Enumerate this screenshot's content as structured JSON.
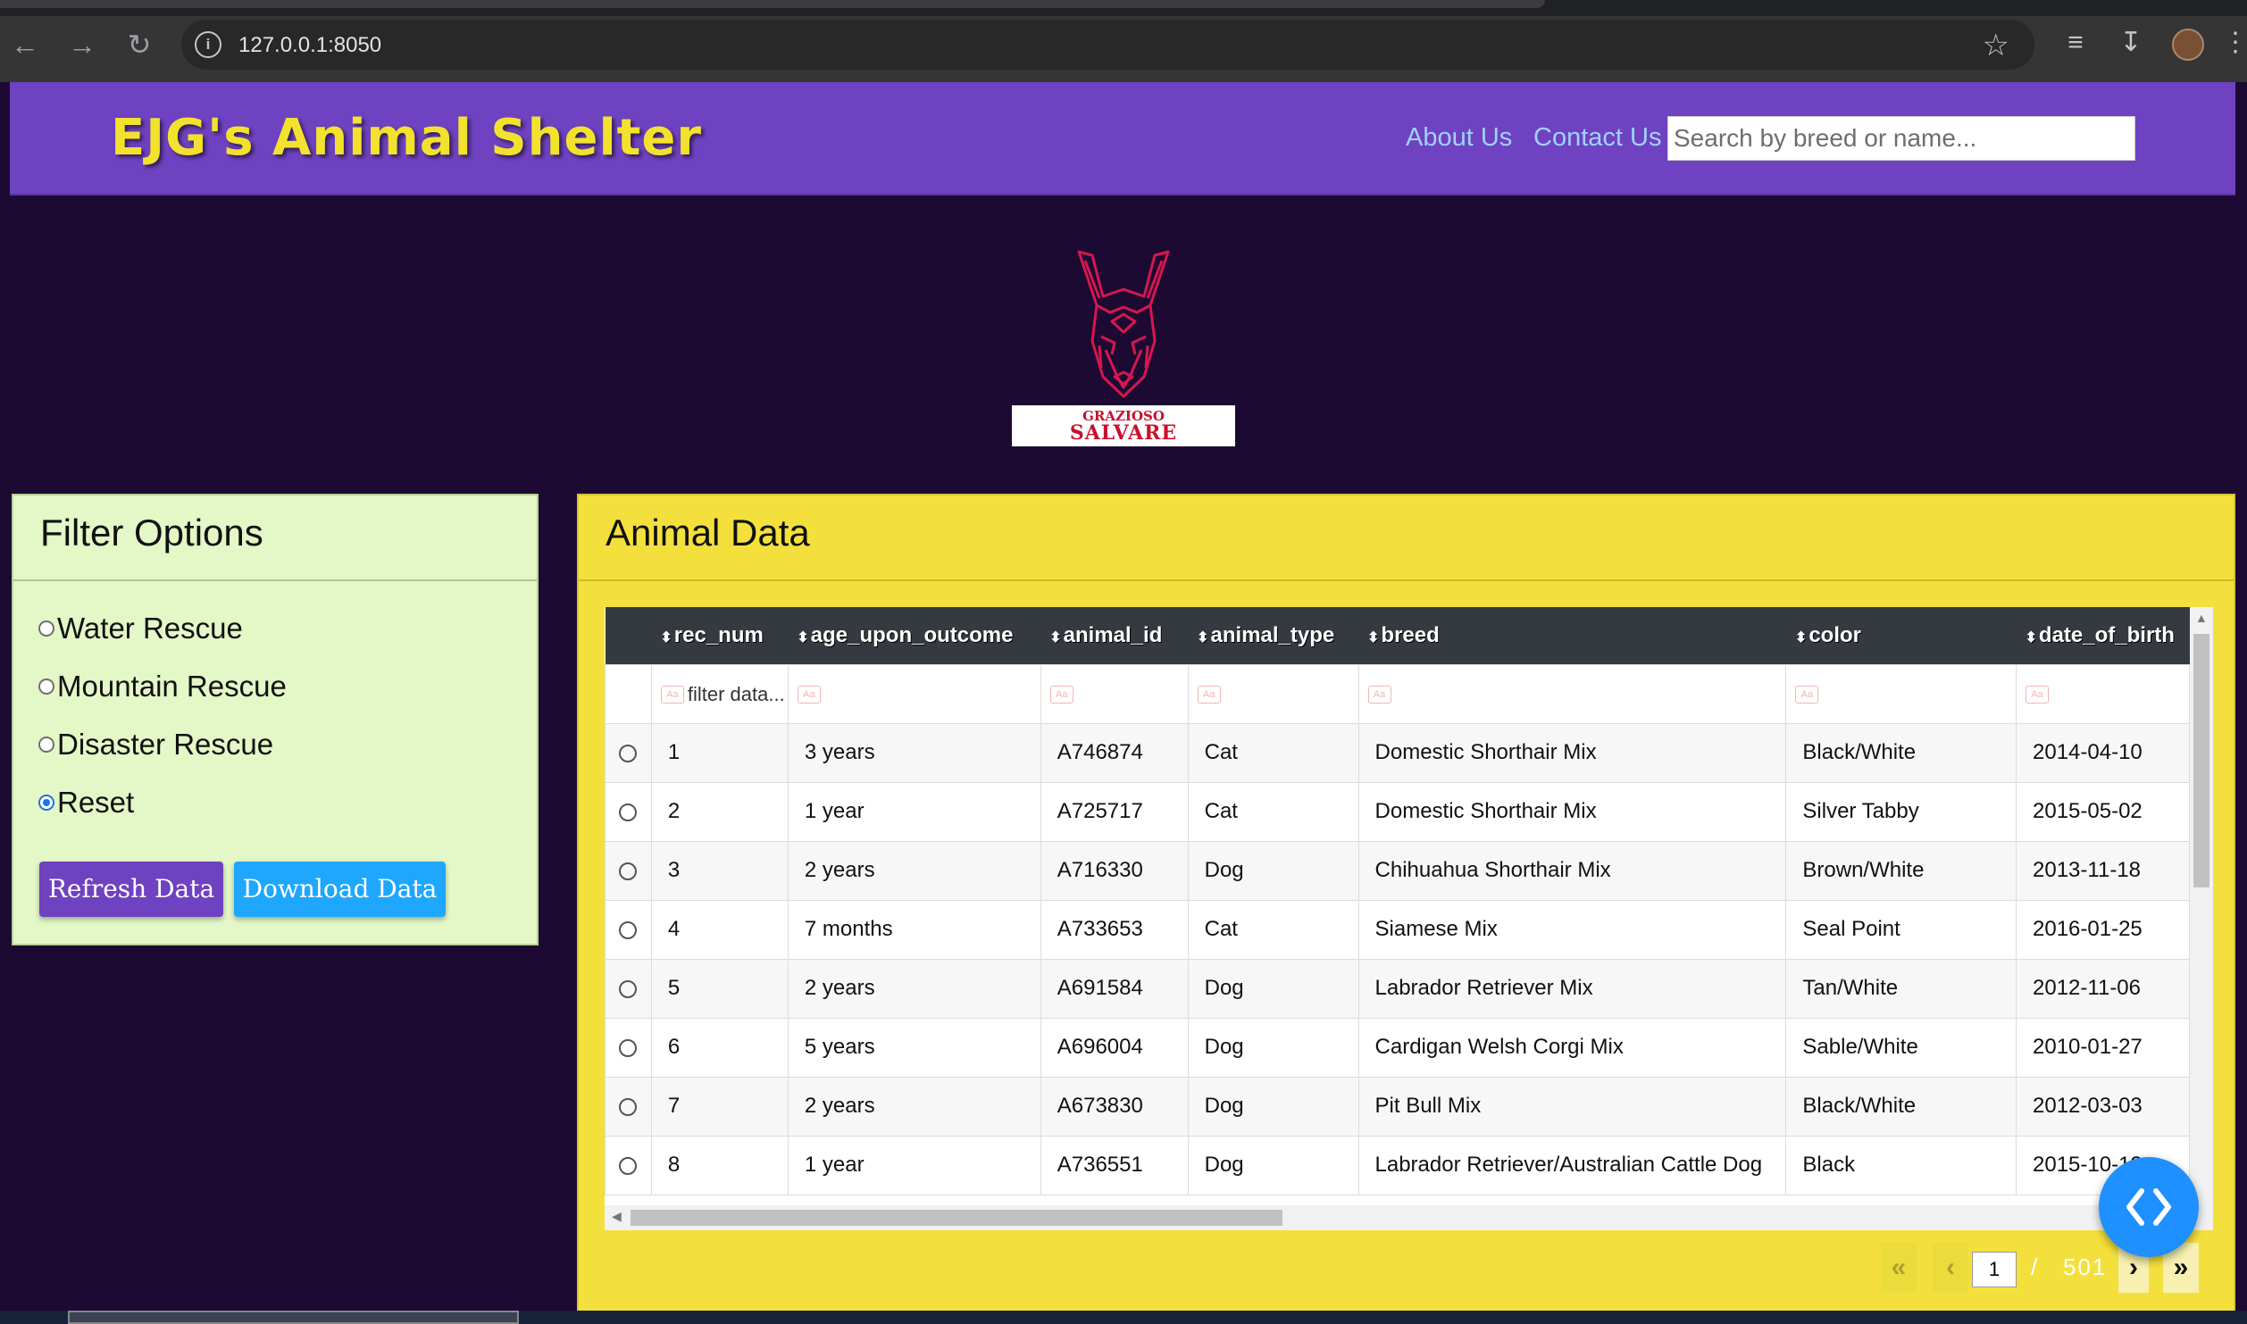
{
  "browser": {
    "url": "127.0.0.1:8050"
  },
  "header": {
    "brand": "EJG's Animal Shelter",
    "nav": [
      "About Us",
      "Contact Us"
    ],
    "search_placeholder": "Search by breed or name..."
  },
  "logo": {
    "line1": "GRAZIOSO",
    "line2": "SALVARE"
  },
  "filter": {
    "title": "Filter Options",
    "options": [
      {
        "label": "Water Rescue",
        "checked": false
      },
      {
        "label": "Mountain Rescue",
        "checked": false
      },
      {
        "label": "Disaster Rescue",
        "checked": false
      },
      {
        "label": "Reset",
        "checked": true
      }
    ],
    "refresh_label": "Refresh Data",
    "download_label": "Download Data"
  },
  "data_card": {
    "title": "Animal Data",
    "columns": [
      "rec_num",
      "age_upon_outcome",
      "animal_id",
      "animal_type",
      "breed",
      "color",
      "date_of_birth"
    ],
    "filter_placeholder": "filter data...",
    "rows": [
      [
        "1",
        "3 years",
        "A746874",
        "Cat",
        "Domestic Shorthair Mix",
        "Black/White",
        "2014-04-10"
      ],
      [
        "2",
        "1 year",
        "A725717",
        "Cat",
        "Domestic Shorthair Mix",
        "Silver Tabby",
        "2015-05-02"
      ],
      [
        "3",
        "2 years",
        "A716330",
        "Dog",
        "Chihuahua Shorthair Mix",
        "Brown/White",
        "2013-11-18"
      ],
      [
        "4",
        "7 months",
        "A733653",
        "Cat",
        "Siamese Mix",
        "Seal Point",
        "2016-01-25"
      ],
      [
        "5",
        "2 years",
        "A691584",
        "Dog",
        "Labrador Retriever Mix",
        "Tan/White",
        "2012-11-06"
      ],
      [
        "6",
        "5 years",
        "A696004",
        "Dog",
        "Cardigan Welsh Corgi Mix",
        "Sable/White",
        "2010-01-27"
      ],
      [
        "7",
        "2 years",
        "A673830",
        "Dog",
        "Pit Bull Mix",
        "Black/White",
        "2012-03-03"
      ],
      [
        "8",
        "1 year",
        "A736551",
        "Dog",
        "Labrador Retriever/Australian Cattle Dog",
        "Black",
        "2015-10-12"
      ]
    ],
    "pager": {
      "current": "1",
      "separator": "/",
      "total": "501"
    }
  },
  "colors": {
    "header_bg": "#6f42c1",
    "brand_text": "#f2e22e",
    "page_bg": "#1c0a33",
    "filter_card_bg": "#e3f7c7",
    "data_card_bg": "#f4e03c",
    "refresh_button": "#6f42c1",
    "download_button": "#1ea7fd"
  }
}
